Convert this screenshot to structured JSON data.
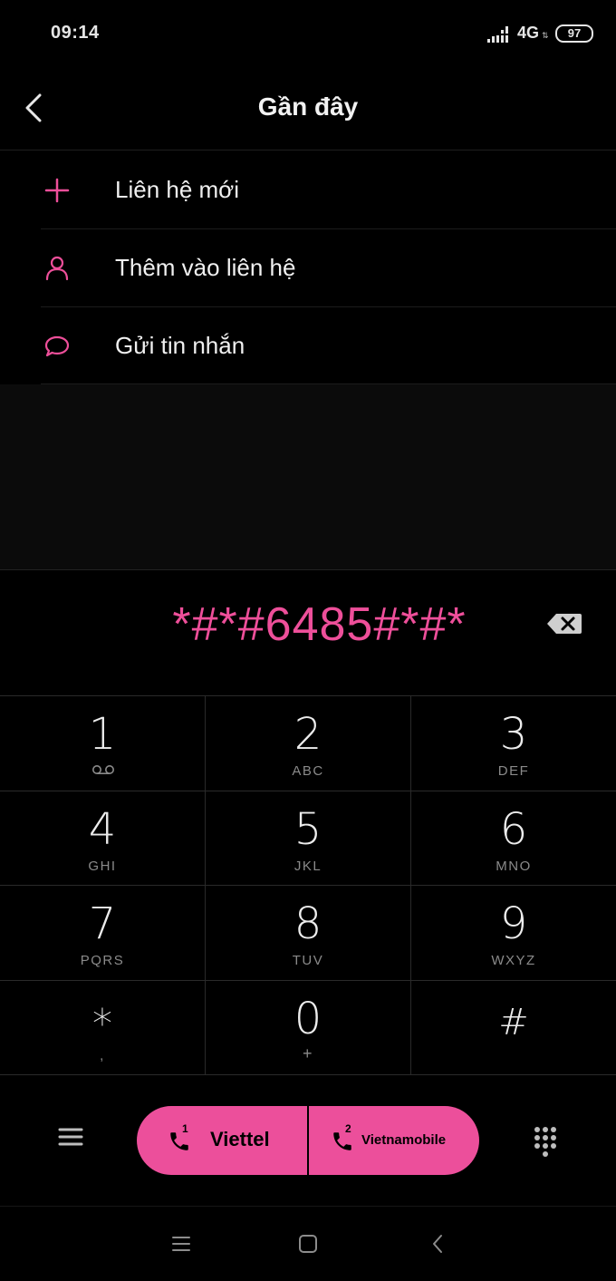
{
  "status": {
    "time": "09:14",
    "network": "4G",
    "network_arrows": "⇅",
    "battery": "97",
    "signal_icon": "signal-bars-icon"
  },
  "header": {
    "title": "Gần đây",
    "back_icon": "chevron-left-icon"
  },
  "menu": {
    "items": [
      {
        "label": "Liên hệ mới",
        "icon": "plus-icon"
      },
      {
        "label": "Thêm vào liên hệ",
        "icon": "person-icon"
      },
      {
        "label": "Gửi tin nhắn",
        "icon": "message-bubble-icon"
      }
    ]
  },
  "dialer": {
    "number": "*#*#6485#*#*",
    "backspace_icon": "backspace-icon"
  },
  "keypad": {
    "keys": [
      {
        "digit": "1",
        "letters": "",
        "sub_icon": "voicemail-icon"
      },
      {
        "digit": "2",
        "letters": "ABC"
      },
      {
        "digit": "3",
        "letters": "DEF"
      },
      {
        "digit": "4",
        "letters": "GHI"
      },
      {
        "digit": "5",
        "letters": "JKL"
      },
      {
        "digit": "6",
        "letters": "MNO"
      },
      {
        "digit": "7",
        "letters": "PQRS"
      },
      {
        "digit": "8",
        "letters": "TUV"
      },
      {
        "digit": "9",
        "letters": "WXYZ"
      },
      {
        "digit": "*",
        "letters": ","
      },
      {
        "digit": "0",
        "letters": "+"
      },
      {
        "digit": "#",
        "letters": ""
      }
    ]
  },
  "actions": {
    "menu_icon": "hamburger-menu-icon",
    "call_sim1": {
      "sim": "1",
      "label": "Viettel",
      "icon": "phone-icon"
    },
    "call_sim2": {
      "sim": "2",
      "label": "Vietnamobile",
      "icon": "phone-icon"
    },
    "dialpad_icon": "dialpad-icon",
    "accent_color": "#ec4f9b"
  },
  "nav": {
    "recents_icon": "menu-lines-icon",
    "home_icon": "home-square-icon",
    "back_icon": "back-triangle-icon"
  }
}
